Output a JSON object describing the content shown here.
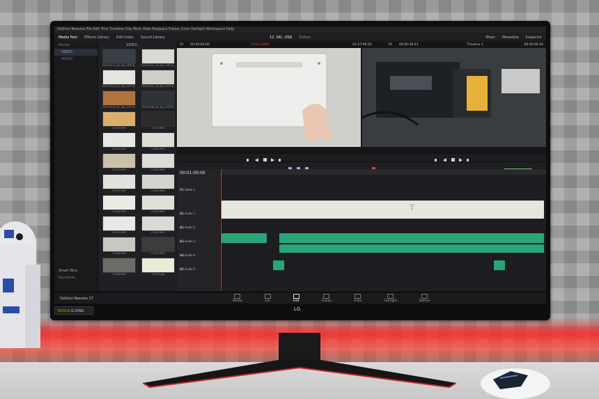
{
  "screen": {
    "menu": "DaVinci Resolve   File   Edit   Trim   Timeline   Clip   Mark   View   Playback   Fusion   Color   Fairlight   Workspace   Help",
    "toolbar": {
      "media_pool": "Media Pool",
      "effects_library": "Effects Library",
      "edit_index": "Edit Index",
      "sound_library": "Sound Library",
      "project_title": "12. SKI...SSD",
      "edited": "Edited",
      "mixer": "Mixer",
      "metadata": "Metadata",
      "inspector": "Inspector"
    },
    "bins": {
      "master": "Master",
      "video": "VIDEO",
      "audio": "AUDIO",
      "smart_bins": "Smart Bins",
      "keywords": "Keywords"
    },
    "media_header": "VIDEO",
    "thumbs": [
      {
        "cap": "DSC00211_ski_bos_CRT18_LUT",
        "color": "#3a3f46"
      },
      {
        "cap": "DSC00212_ski_bos_CRT18_LUT",
        "color": "#d9d9d4"
      },
      {
        "cap": "DSC00213_ski_bos_CRT18_LUT",
        "color": "#e4e4e0"
      },
      {
        "cap": "DSC00214_ski_bos_CRT18_LUT",
        "color": "#cfcfca"
      },
      {
        "cap": "DSC00215_ski_bos_CRT18_LUT",
        "color": "#b0733e"
      },
      {
        "cap": "DSC00216_ski_bos_CRT18_LUT",
        "color": "#2e3336"
      },
      {
        "cap": "C0309.MP4",
        "color": "#d8b06a"
      },
      {
        "cap": "C0310.MP4",
        "color": "#2b2b2b"
      },
      {
        "cap": "C0315.MP4",
        "color": "#e6e6e2"
      },
      {
        "cap": "C0322.MP4",
        "color": "#deded9"
      },
      {
        "cap": "C0323.MP4",
        "color": "#c9c2a8"
      },
      {
        "cap": "C0325.MP4",
        "color": "#dcdcd6"
      },
      {
        "cap": "C0327.MP4",
        "color": "#e2e2dd"
      },
      {
        "cap": "C0332.MP4",
        "color": "#d5d5cf"
      },
      {
        "cap": "C0335.MP4",
        "color": "#ebebe6"
      },
      {
        "cap": "C0336.MP4",
        "color": "#e0e0db"
      },
      {
        "cap": "C0337.MP4",
        "color": "#e8e8e3"
      },
      {
        "cap": "C0345.MP4",
        "color": "#dadad5"
      },
      {
        "cap": "C0346.MP4",
        "color": "#c8c8c3"
      },
      {
        "cap": "C0347.MP4",
        "color": "#3c3c3c"
      },
      {
        "cap": "C0348.MP4",
        "color": "#6c6c68"
      },
      {
        "cap": "C0353.jpg",
        "color": "#e9ecd6"
      }
    ],
    "viewer_left": {
      "zoom": "Fit",
      "timecode": "00:00:00:00",
      "clip": "C0353.MP4"
    },
    "viewer_right": {
      "zoom": "Fit",
      "timecode": "00:00:39:23",
      "sequence": "Timeline 1",
      "tc2": "01:27:09:20",
      "tc3": "00:00:04:20"
    },
    "timeline": {
      "timecode": "00:01:00:00",
      "tracks": [
        {
          "id": "V1",
          "name": "Video 1"
        },
        {
          "id": "A1",
          "name": "Audio 1"
        },
        {
          "id": "A2",
          "name": "Audio 2"
        },
        {
          "id": "A3",
          "name": "Audio 3"
        },
        {
          "id": "A4",
          "name": "Audio 4"
        },
        {
          "id": "A5",
          "name": "Audio 5"
        }
      ],
      "title_glyph": "T"
    },
    "pages": [
      {
        "label": "Media",
        "active": false
      },
      {
        "label": "Cut",
        "active": false
      },
      {
        "label": "Edit",
        "active": true
      },
      {
        "label": "Fusion",
        "active": false
      },
      {
        "label": "Color",
        "active": false
      },
      {
        "label": "Fairlight",
        "active": false
      },
      {
        "label": "Deliver",
        "active": false
      }
    ],
    "app_name": "DaVinci Resolve 17"
  },
  "bezel": {
    "nvidia": "NVIDIA",
    "gsync": "G-SYNC",
    "brand": "LG"
  }
}
